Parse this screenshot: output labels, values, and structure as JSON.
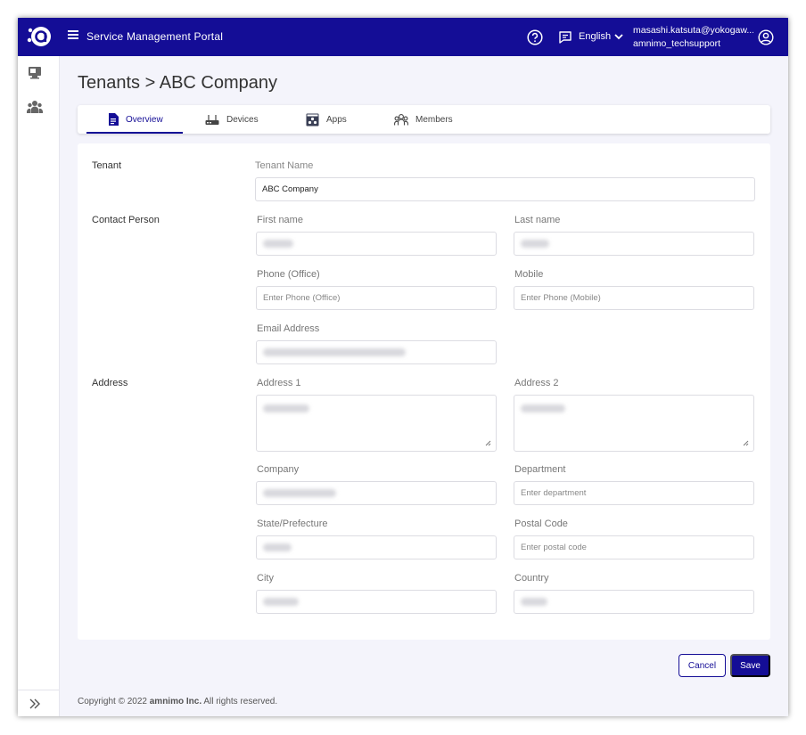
{
  "header": {
    "title": "Service Management Portal",
    "language": "English",
    "user_email": "masashi.katsuta@yokogaw...",
    "user_role": "amnimo_techsupport",
    "brand_color": "#140d96"
  },
  "breadcrumb": "Tenants > ABC Company",
  "tabs": [
    {
      "label": "Overview",
      "icon": "document-icon",
      "active": true
    },
    {
      "label": "Devices",
      "icon": "router-icon",
      "active": false
    },
    {
      "label": "Apps",
      "icon": "apps-icon",
      "active": false
    },
    {
      "label": "Members",
      "icon": "people-icon",
      "active": false
    }
  ],
  "form": {
    "tenant": {
      "section": "Tenant",
      "name_label": "Tenant Name",
      "name_value": "ABC Company"
    },
    "contact": {
      "section": "Contact Person",
      "first_name_label": "First name",
      "last_name_label": "Last name",
      "phone_office_label": "Phone (Office)",
      "phone_office_placeholder": "Enter Phone (Office)",
      "mobile_label": "Mobile",
      "mobile_placeholder": "Enter Phone (Mobile)",
      "email_label": "Email Address"
    },
    "address": {
      "section": "Address",
      "address1_label": "Address 1",
      "address2_label": "Address 2",
      "company_label": "Company",
      "department_label": "Department",
      "department_placeholder": "Enter department",
      "state_label": "State/Prefecture",
      "postal_label": "Postal Code",
      "postal_placeholder": "Enter postal code",
      "city_label": "City",
      "country_label": "Country"
    }
  },
  "buttons": {
    "cancel": "Cancel",
    "save": "Save"
  },
  "footer": {
    "prefix": "Copyright © 2022 ",
    "company": "amnimo Inc.",
    "suffix": " All rights reserved."
  }
}
